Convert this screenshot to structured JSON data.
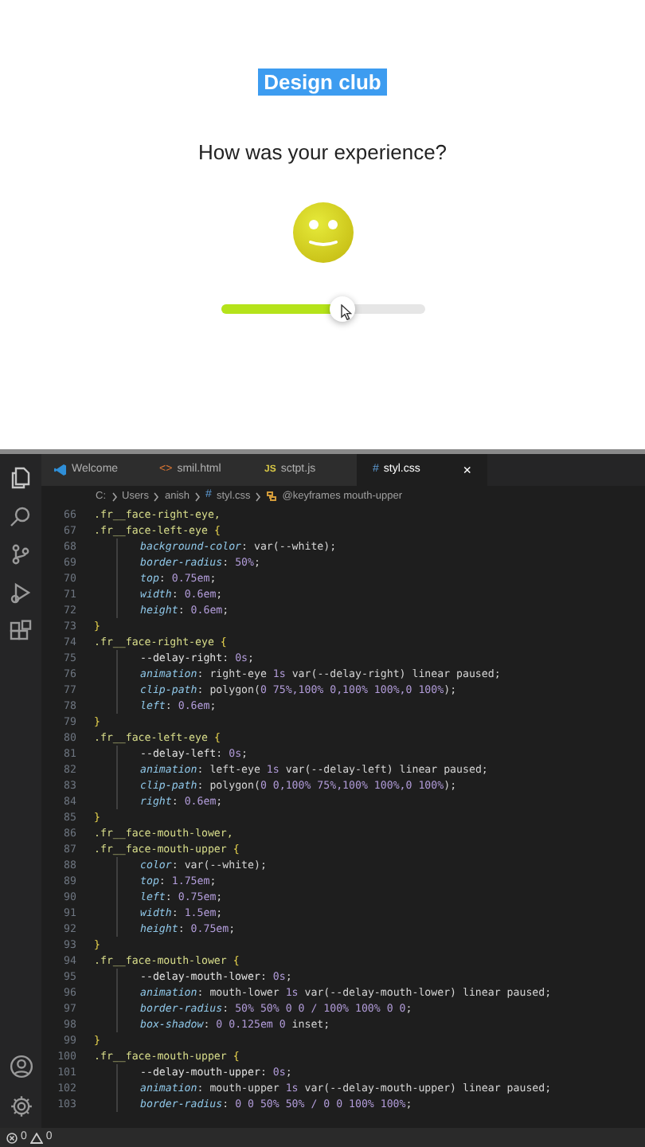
{
  "preview": {
    "badge": "Design club",
    "question": "How was your experience?",
    "slider": {
      "level": 0.6
    }
  },
  "editor": {
    "tabs": [
      {
        "label": "Welcome",
        "selected": false
      },
      {
        "label": "smil.html",
        "glyph": "<>",
        "selected": false
      },
      {
        "label": "sctpt.js",
        "glyph": "JS",
        "selected": false
      },
      {
        "label": "styl.css",
        "glyph": "#",
        "selected": true,
        "close": "×"
      }
    ],
    "breadcrumb": [
      {
        "text": "C:"
      },
      {
        "text": "Users"
      },
      {
        "text": "anish"
      },
      {
        "text": "styl.css",
        "glyph": "#"
      },
      {
        "text": "@keyframes mouth-upper"
      }
    ],
    "lines": [
      {
        "number": "66",
        "indent": false,
        "tokens": [
          {
            "kind": "sel",
            "text": ".fr__face-right-eye,"
          }
        ]
      },
      {
        "number": "67",
        "indent": false,
        "tokens": [
          {
            "kind": "sel",
            "text": ".fr__face-left-eye"
          },
          {
            "kind": "brace",
            "text": " {"
          }
        ]
      },
      {
        "number": "68",
        "indent": true,
        "tokens": [
          {
            "kind": "prop",
            "text": "background-color"
          },
          {
            "kind": "punct",
            "text": ": "
          },
          {
            "kind": "val",
            "text": "var(--white)"
          },
          {
            "kind": "punct",
            "text": ";"
          }
        ]
      },
      {
        "number": "69",
        "indent": true,
        "tokens": [
          {
            "kind": "prop",
            "text": "border-radius"
          },
          {
            "kind": "punct",
            "text": ": "
          },
          {
            "kind": "num",
            "text": "50%"
          },
          {
            "kind": "punct",
            "text": ";"
          }
        ]
      },
      {
        "number": "70",
        "indent": true,
        "tokens": [
          {
            "kind": "prop",
            "text": "top"
          },
          {
            "kind": "punct",
            "text": ": "
          },
          {
            "kind": "num",
            "text": "0.75em"
          },
          {
            "kind": "punct",
            "text": ";"
          }
        ]
      },
      {
        "number": "71",
        "indent": true,
        "tokens": [
          {
            "kind": "prop",
            "text": "width"
          },
          {
            "kind": "punct",
            "text": ": "
          },
          {
            "kind": "num",
            "text": "0.6em"
          },
          {
            "kind": "punct",
            "text": ";"
          }
        ]
      },
      {
        "number": "72",
        "indent": true,
        "tokens": [
          {
            "kind": "prop",
            "text": "height"
          },
          {
            "kind": "punct",
            "text": ": "
          },
          {
            "kind": "num",
            "text": "0.6em"
          },
          {
            "kind": "punct",
            "text": ";"
          }
        ]
      },
      {
        "number": "73",
        "indent": false,
        "tokens": [
          {
            "kind": "brace",
            "text": "}"
          }
        ]
      },
      {
        "number": "74",
        "indent": false,
        "tokens": [
          {
            "kind": "sel",
            "text": ".fr__face-right-eye"
          },
          {
            "kind": "brace",
            "text": " {"
          }
        ]
      },
      {
        "number": "75",
        "indent": true,
        "tokens": [
          {
            "kind": "var",
            "text": "--delay-right"
          },
          {
            "kind": "punct",
            "text": ": "
          },
          {
            "kind": "num",
            "text": "0s"
          },
          {
            "kind": "punct",
            "text": ";"
          }
        ]
      },
      {
        "number": "76",
        "indent": true,
        "tokens": [
          {
            "kind": "prop",
            "text": "animation"
          },
          {
            "kind": "punct",
            "text": ": "
          },
          {
            "kind": "val",
            "text": "right-eye "
          },
          {
            "kind": "num",
            "text": "1s"
          },
          {
            "kind": "val",
            "text": " var(--delay-right) linear paused"
          },
          {
            "kind": "punct",
            "text": ";"
          }
        ]
      },
      {
        "number": "77",
        "indent": true,
        "tokens": [
          {
            "kind": "prop",
            "text": "clip-path"
          },
          {
            "kind": "punct",
            "text": ": "
          },
          {
            "kind": "val",
            "text": "polygon("
          },
          {
            "kind": "num",
            "text": "0 75%,100% 0,100% 100%,0 100%"
          },
          {
            "kind": "val",
            "text": ")"
          },
          {
            "kind": "punct",
            "text": ";"
          }
        ]
      },
      {
        "number": "78",
        "indent": true,
        "tokens": [
          {
            "kind": "prop",
            "text": "left"
          },
          {
            "kind": "punct",
            "text": ": "
          },
          {
            "kind": "num",
            "text": "0.6em"
          },
          {
            "kind": "punct",
            "text": ";"
          }
        ]
      },
      {
        "number": "79",
        "indent": false,
        "tokens": [
          {
            "kind": "brace",
            "text": "}"
          }
        ]
      },
      {
        "number": "80",
        "indent": false,
        "tokens": [
          {
            "kind": "sel",
            "text": ".fr__face-left-eye"
          },
          {
            "kind": "brace",
            "text": " {"
          }
        ]
      },
      {
        "number": "81",
        "indent": true,
        "tokens": [
          {
            "kind": "var",
            "text": "--delay-left"
          },
          {
            "kind": "punct",
            "text": ": "
          },
          {
            "kind": "num",
            "text": "0s"
          },
          {
            "kind": "punct",
            "text": ";"
          }
        ]
      },
      {
        "number": "82",
        "indent": true,
        "tokens": [
          {
            "kind": "prop",
            "text": "animation"
          },
          {
            "kind": "punct",
            "text": ": "
          },
          {
            "kind": "val",
            "text": "left-eye "
          },
          {
            "kind": "num",
            "text": "1s"
          },
          {
            "kind": "val",
            "text": " var(--delay-left) linear paused"
          },
          {
            "kind": "punct",
            "text": ";"
          }
        ]
      },
      {
        "number": "83",
        "indent": true,
        "tokens": [
          {
            "kind": "prop",
            "text": "clip-path"
          },
          {
            "kind": "punct",
            "text": ": "
          },
          {
            "kind": "val",
            "text": "polygon("
          },
          {
            "kind": "num",
            "text": "0 0,100% 75%,100% 100%,0 100%"
          },
          {
            "kind": "val",
            "text": ")"
          },
          {
            "kind": "punct",
            "text": ";"
          }
        ]
      },
      {
        "number": "84",
        "indent": true,
        "tokens": [
          {
            "kind": "prop",
            "text": "right"
          },
          {
            "kind": "punct",
            "text": ": "
          },
          {
            "kind": "num",
            "text": "0.6em"
          },
          {
            "kind": "punct",
            "text": ";"
          }
        ]
      },
      {
        "number": "85",
        "indent": false,
        "tokens": [
          {
            "kind": "brace",
            "text": "}"
          }
        ]
      },
      {
        "number": "86",
        "indent": false,
        "tokens": [
          {
            "kind": "sel",
            "text": ".fr__face-mouth-lower,"
          }
        ]
      },
      {
        "number": "87",
        "indent": false,
        "tokens": [
          {
            "kind": "sel",
            "text": ".fr__face-mouth-upper"
          },
          {
            "kind": "brace",
            "text": " {"
          }
        ]
      },
      {
        "number": "88",
        "indent": true,
        "tokens": [
          {
            "kind": "prop",
            "text": "color"
          },
          {
            "kind": "punct",
            "text": ": "
          },
          {
            "kind": "val",
            "text": "var(--white)"
          },
          {
            "kind": "punct",
            "text": ";"
          }
        ]
      },
      {
        "number": "89",
        "indent": true,
        "tokens": [
          {
            "kind": "prop",
            "text": "top"
          },
          {
            "kind": "punct",
            "text": ": "
          },
          {
            "kind": "num",
            "text": "1.75em"
          },
          {
            "kind": "punct",
            "text": ";"
          }
        ]
      },
      {
        "number": "90",
        "indent": true,
        "tokens": [
          {
            "kind": "prop",
            "text": "left"
          },
          {
            "kind": "punct",
            "text": ": "
          },
          {
            "kind": "num",
            "text": "0.75em"
          },
          {
            "kind": "punct",
            "text": ";"
          }
        ]
      },
      {
        "number": "91",
        "indent": true,
        "tokens": [
          {
            "kind": "prop",
            "text": "width"
          },
          {
            "kind": "punct",
            "text": ": "
          },
          {
            "kind": "num",
            "text": "1.5em"
          },
          {
            "kind": "punct",
            "text": ";"
          }
        ]
      },
      {
        "number": "92",
        "indent": true,
        "tokens": [
          {
            "kind": "prop",
            "text": "height"
          },
          {
            "kind": "punct",
            "text": ": "
          },
          {
            "kind": "num",
            "text": "0.75em"
          },
          {
            "kind": "punct",
            "text": ";"
          }
        ]
      },
      {
        "number": "93",
        "indent": false,
        "tokens": [
          {
            "kind": "brace",
            "text": "}"
          }
        ]
      },
      {
        "number": "94",
        "indent": false,
        "tokens": [
          {
            "kind": "sel",
            "text": ".fr__face-mouth-lower"
          },
          {
            "kind": "brace",
            "text": " {"
          }
        ]
      },
      {
        "number": "95",
        "indent": true,
        "tokens": [
          {
            "kind": "var",
            "text": "--delay-mouth-lower"
          },
          {
            "kind": "punct",
            "text": ": "
          },
          {
            "kind": "num",
            "text": "0s"
          },
          {
            "kind": "punct",
            "text": ";"
          }
        ]
      },
      {
        "number": "96",
        "indent": true,
        "tokens": [
          {
            "kind": "prop",
            "text": "animation"
          },
          {
            "kind": "punct",
            "text": ": "
          },
          {
            "kind": "val",
            "text": "mouth-lower "
          },
          {
            "kind": "num",
            "text": "1s"
          },
          {
            "kind": "val",
            "text": " var(--delay-mouth-lower) linear paused"
          },
          {
            "kind": "punct",
            "text": ";"
          }
        ]
      },
      {
        "number": "97",
        "indent": true,
        "tokens": [
          {
            "kind": "prop",
            "text": "border-radius"
          },
          {
            "kind": "punct",
            "text": ": "
          },
          {
            "kind": "num",
            "text": "50% 50% 0 0 / 100% 100% 0 0"
          },
          {
            "kind": "punct",
            "text": ";"
          }
        ]
      },
      {
        "number": "98",
        "indent": true,
        "tokens": [
          {
            "kind": "prop",
            "text": "box-shadow"
          },
          {
            "kind": "punct",
            "text": ": "
          },
          {
            "kind": "num",
            "text": "0 0.125em 0"
          },
          {
            "kind": "val",
            "text": " inset"
          },
          {
            "kind": "punct",
            "text": ";"
          }
        ]
      },
      {
        "number": "99",
        "indent": false,
        "tokens": [
          {
            "kind": "brace",
            "text": "}"
          }
        ]
      },
      {
        "number": "100",
        "indent": false,
        "tokens": [
          {
            "kind": "sel",
            "text": ".fr__face-mouth-upper"
          },
          {
            "kind": "brace",
            "text": " {"
          }
        ]
      },
      {
        "number": "101",
        "indent": true,
        "tokens": [
          {
            "kind": "var",
            "text": "--delay-mouth-upper"
          },
          {
            "kind": "punct",
            "text": ": "
          },
          {
            "kind": "num",
            "text": "0s"
          },
          {
            "kind": "punct",
            "text": ";"
          }
        ]
      },
      {
        "number": "102",
        "indent": true,
        "tokens": [
          {
            "kind": "prop",
            "text": "animation"
          },
          {
            "kind": "punct",
            "text": ": "
          },
          {
            "kind": "val",
            "text": "mouth-upper "
          },
          {
            "kind": "num",
            "text": "1s"
          },
          {
            "kind": "val",
            "text": " var(--delay-mouth-upper) linear paused"
          },
          {
            "kind": "punct",
            "text": ";"
          }
        ]
      },
      {
        "number": "103",
        "indent": true,
        "tokens": [
          {
            "kind": "prop",
            "text": "border-radius"
          },
          {
            "kind": "punct",
            "text": ": "
          },
          {
            "kind": "num",
            "text": "0 0 50% 50% / 0 0 100% 100%"
          },
          {
            "kind": "punct",
            "text": ";"
          }
        ]
      }
    ],
    "status_bar": {
      "errors": "0",
      "warnings": "0"
    }
  }
}
